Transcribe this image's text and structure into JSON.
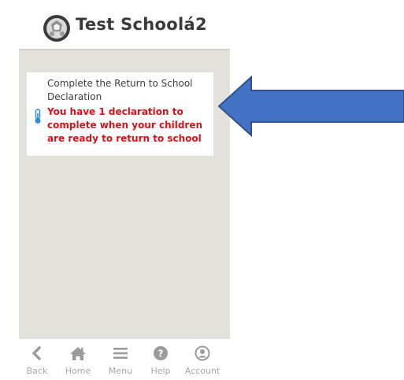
{
  "header": {
    "title": "Test Schoolá2",
    "logo_icon": "school-logo-icon"
  },
  "card": {
    "title": "Complete the Return to School Declaration",
    "message": "You have 1 declaration to complete when your children are ready to return to school",
    "icon": "thermometer-icon",
    "message_color": "#d4141b"
  },
  "tabbar": {
    "items": [
      {
        "label": "Back",
        "icon": "chevron-left-icon"
      },
      {
        "label": "Home",
        "icon": "home-icon"
      },
      {
        "label": "Menu",
        "icon": "hamburger-menu-icon"
      },
      {
        "label": "Help",
        "icon": "help-icon"
      },
      {
        "label": "Account",
        "icon": "account-icon"
      }
    ]
  },
  "annotation": {
    "arrow_icon": "left-arrow-icon",
    "arrow_color": "#4472c4"
  }
}
